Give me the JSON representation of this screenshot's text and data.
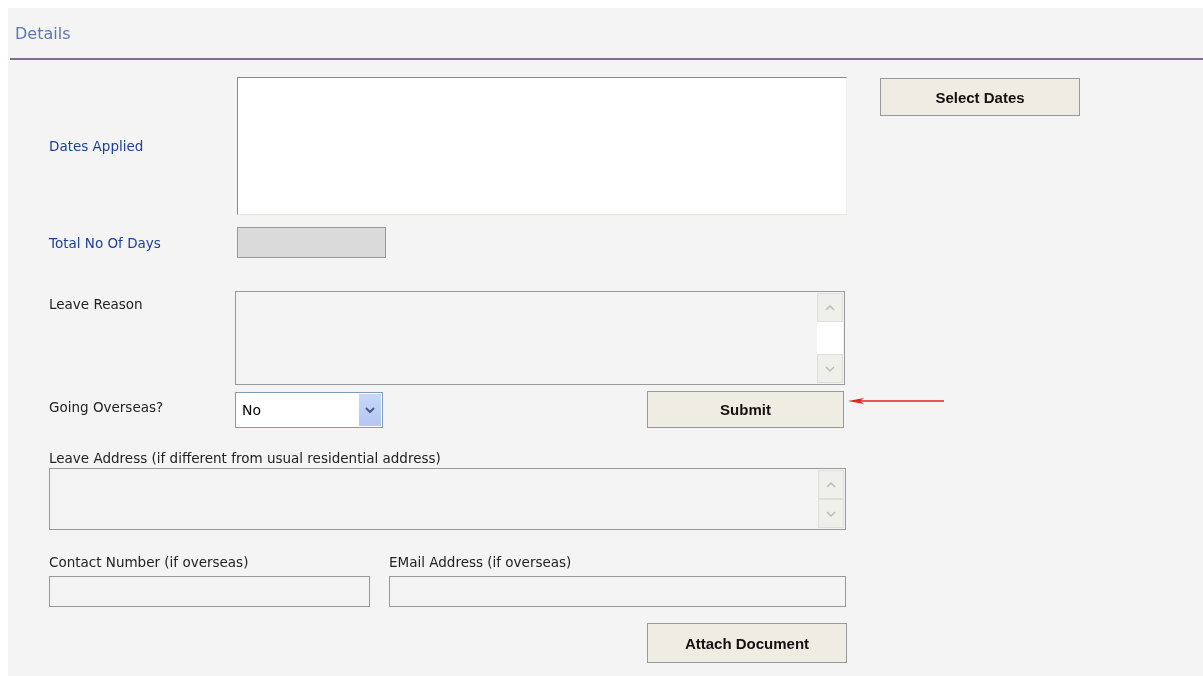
{
  "section_title": "Details",
  "dates_applied": {
    "label": "Dates Applied"
  },
  "select_dates_button": "Select Dates",
  "total_days": {
    "label": "Total No Of Days",
    "disabled": true
  },
  "leave_reason": {
    "label": "Leave Reason"
  },
  "going_overseas": {
    "label": "Going Overseas?",
    "value": "No"
  },
  "submit_button": "Submit",
  "leave_address": {
    "label": "Leave Address (if different from usual residential address)"
  },
  "contact_number": {
    "label": "Contact Number (if overseas)"
  },
  "email_address": {
    "label": "EMail Address (if overseas)"
  },
  "attach_button": "Attach Document"
}
